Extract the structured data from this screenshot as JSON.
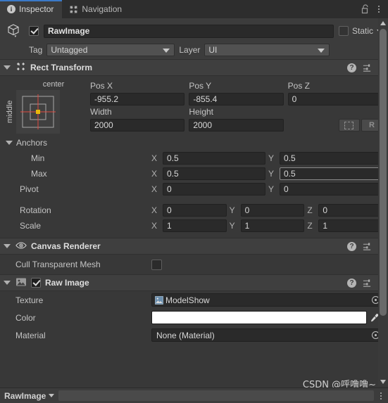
{
  "window": {
    "tabs": [
      {
        "label": "Inspector",
        "icon": "info-icon",
        "active": true
      },
      {
        "label": "Navigation",
        "icon": "navigation-move-icon",
        "active": false
      }
    ],
    "lock_icon": "lock-open-icon",
    "menu_icon": "kebab-menu-icon"
  },
  "gameobject": {
    "icon": "cube-icon",
    "enabled": true,
    "name": "RawImage",
    "static_label": "Static",
    "static_checked": false,
    "tag_label": "Tag",
    "tag_value": "Untagged",
    "layer_label": "Layer",
    "layer_value": "UI"
  },
  "rect_transform": {
    "title": "Rect Transform",
    "icon": "rect-transform-icon",
    "expanded": true,
    "anchor_preset": {
      "horizontal": "center",
      "vertical": "middle"
    },
    "pos": {
      "x_label": "Pos X",
      "x_value": "-955.2",
      "y_label": "Pos Y",
      "y_value": "-855.4",
      "z_label": "Pos Z",
      "z_value": "0"
    },
    "size": {
      "w_label": "Width",
      "w_value": "2000",
      "h_label": "Height",
      "h_value": "2000"
    },
    "blueprint_button": "blueprint-mode-icon",
    "rawedit_button": "R",
    "anchors": {
      "label": "Anchors",
      "min_label": "Min",
      "min_x": "0.5",
      "min_y": "0.5",
      "max_label": "Max",
      "max_x": "0.5",
      "max_y": "0.5",
      "pivot_label": "Pivot",
      "pivot_x": "0",
      "pivot_y": "0"
    },
    "rotation": {
      "label": "Rotation",
      "x": "0",
      "y": "0",
      "z": "0"
    },
    "scale": {
      "label": "Scale",
      "x": "1",
      "y": "1",
      "z": "1"
    },
    "axis_x": "X",
    "axis_y": "Y",
    "axis_z": "Z"
  },
  "canvas_renderer": {
    "title": "Canvas Renderer",
    "icon": "eye-icon",
    "expanded": true,
    "cull_label": "Cull Transparent Mesh",
    "cull_checked": false
  },
  "raw_image": {
    "title": "Raw Image",
    "icon": "image-icon",
    "enabled": true,
    "expanded": true,
    "texture_label": "Texture",
    "texture_value": "ModelShow",
    "color_label": "Color",
    "color_value": "#FFFFFF",
    "material_label": "Material",
    "material_value": "None (Material)"
  },
  "bottom_bar": {
    "name": "RawImage"
  },
  "watermark": "CSDN @呼噜噜~",
  "colors": {
    "accent_tab": "#3a79c8",
    "panel": "#383838",
    "header": "#3f3f3f",
    "field": "#2a2a2a",
    "anchor_cross": "#e04a3f",
    "pivot_dot": "#e8b90b"
  }
}
